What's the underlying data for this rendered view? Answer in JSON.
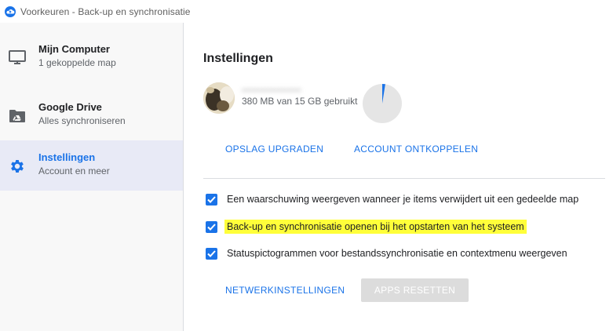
{
  "window": {
    "title": "Voorkeuren - Back-up en synchronisatie",
    "icon": "backup-sync-cloud-icon"
  },
  "sidebar": {
    "items": [
      {
        "title": "Mijn Computer",
        "subtitle": "1 gekoppelde map",
        "icon": "monitor-icon",
        "active": false
      },
      {
        "title": "Google Drive",
        "subtitle": "Alles synchroniseren",
        "icon": "drive-folder-icon",
        "active": false
      },
      {
        "title": "Instellingen",
        "subtitle": "Account en meer",
        "icon": "gear-icon",
        "active": true
      }
    ]
  },
  "main": {
    "heading": "Instellingen",
    "account": {
      "email": "••••••••••••••••••",
      "usage": "380 MB van 15 GB gebruikt",
      "used_fraction": 0.025
    },
    "buttons": {
      "upgrade": "OPSLAG UPGRADEN",
      "disconnect": "ACCOUNT ONTKOPPELEN",
      "network": "NETWERKINSTELLINGEN",
      "reset_apps": "APPS RESETTEN"
    },
    "options": [
      {
        "label": "Een waarschuwing weergeven wanneer je items verwijdert uit een gedeelde map",
        "checked": true
      },
      {
        "label": "Back-up en synchronisatie openen bij het opstarten van het systeem",
        "checked": true
      },
      {
        "label": "Statuspictogrammen voor bestandssynchronisatie en contextmenu weergeven",
        "checked": true
      }
    ]
  },
  "colors": {
    "accent": "#1a73e8",
    "highlight": "#ffff3a",
    "active_nav": "#e8eaf6",
    "disabled_button": "#dcdcdc"
  }
}
